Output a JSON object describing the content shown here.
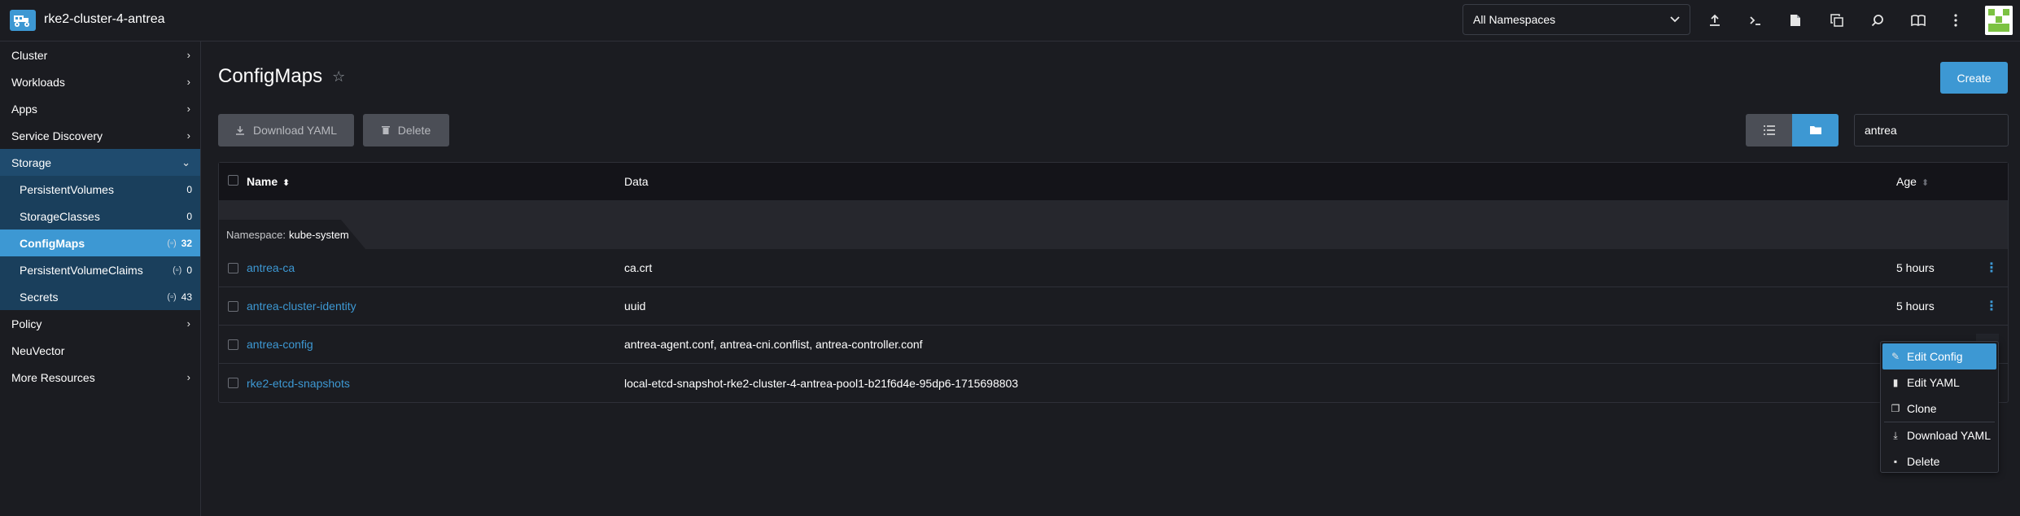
{
  "header": {
    "cluster_name": "rke2-cluster-4-antrea",
    "namespace_select": "All Namespaces"
  },
  "sidebar": {
    "groups": [
      {
        "label": "Cluster"
      },
      {
        "label": "Workloads"
      },
      {
        "label": "Apps"
      },
      {
        "label": "Service Discovery"
      },
      {
        "label": "Storage"
      }
    ],
    "storage_items": [
      {
        "label": "PersistentVolumes",
        "count": "0",
        "namespaced": false
      },
      {
        "label": "StorageClasses",
        "count": "0",
        "namespaced": false
      },
      {
        "label": "ConfigMaps",
        "count": "32",
        "namespaced": true
      },
      {
        "label": "PersistentVolumeClaims",
        "count": "0",
        "namespaced": true
      },
      {
        "label": "Secrets",
        "count": "43",
        "namespaced": true
      }
    ],
    "after_groups": [
      {
        "label": "Policy"
      },
      {
        "label": "NeuVector"
      },
      {
        "label": "More Resources"
      }
    ]
  },
  "page": {
    "title": "ConfigMaps",
    "create_label": "Create",
    "download_yaml_label": "Download YAML",
    "delete_label": "Delete",
    "search_value": "antrea"
  },
  "table": {
    "columns": {
      "name": "Name",
      "data": "Data",
      "age": "Age"
    },
    "group_prefix": "Namespace:",
    "group_name": "kube-system",
    "rows": [
      {
        "name": "antrea-ca",
        "data": "ca.crt",
        "age": "5 hours"
      },
      {
        "name": "antrea-cluster-identity",
        "data": "uuid",
        "age": "5 hours"
      },
      {
        "name": "antrea-config",
        "data": "antrea-agent.conf, antrea-cni.conflist, antrea-controller.conf",
        "age": ""
      },
      {
        "name": "rke2-etcd-snapshots",
        "data": "local-etcd-snapshot-rke2-cluster-4-antrea-pool1-b21f6d4e-95dp6-1715698803",
        "age": ""
      }
    ]
  },
  "context_menu": {
    "items": [
      {
        "label": "Edit Config",
        "icon": "pencil-icon"
      },
      {
        "label": "Edit YAML",
        "icon": "file-icon"
      },
      {
        "label": "Clone",
        "icon": "copy-icon"
      },
      {
        "label": "Download YAML",
        "icon": "download-icon"
      },
      {
        "label": "Delete",
        "icon": "trash-icon"
      }
    ]
  },
  "colors": {
    "accent": "#3d98d3",
    "background": "#1b1c21",
    "sidebar_active": "#1f4b6e"
  }
}
